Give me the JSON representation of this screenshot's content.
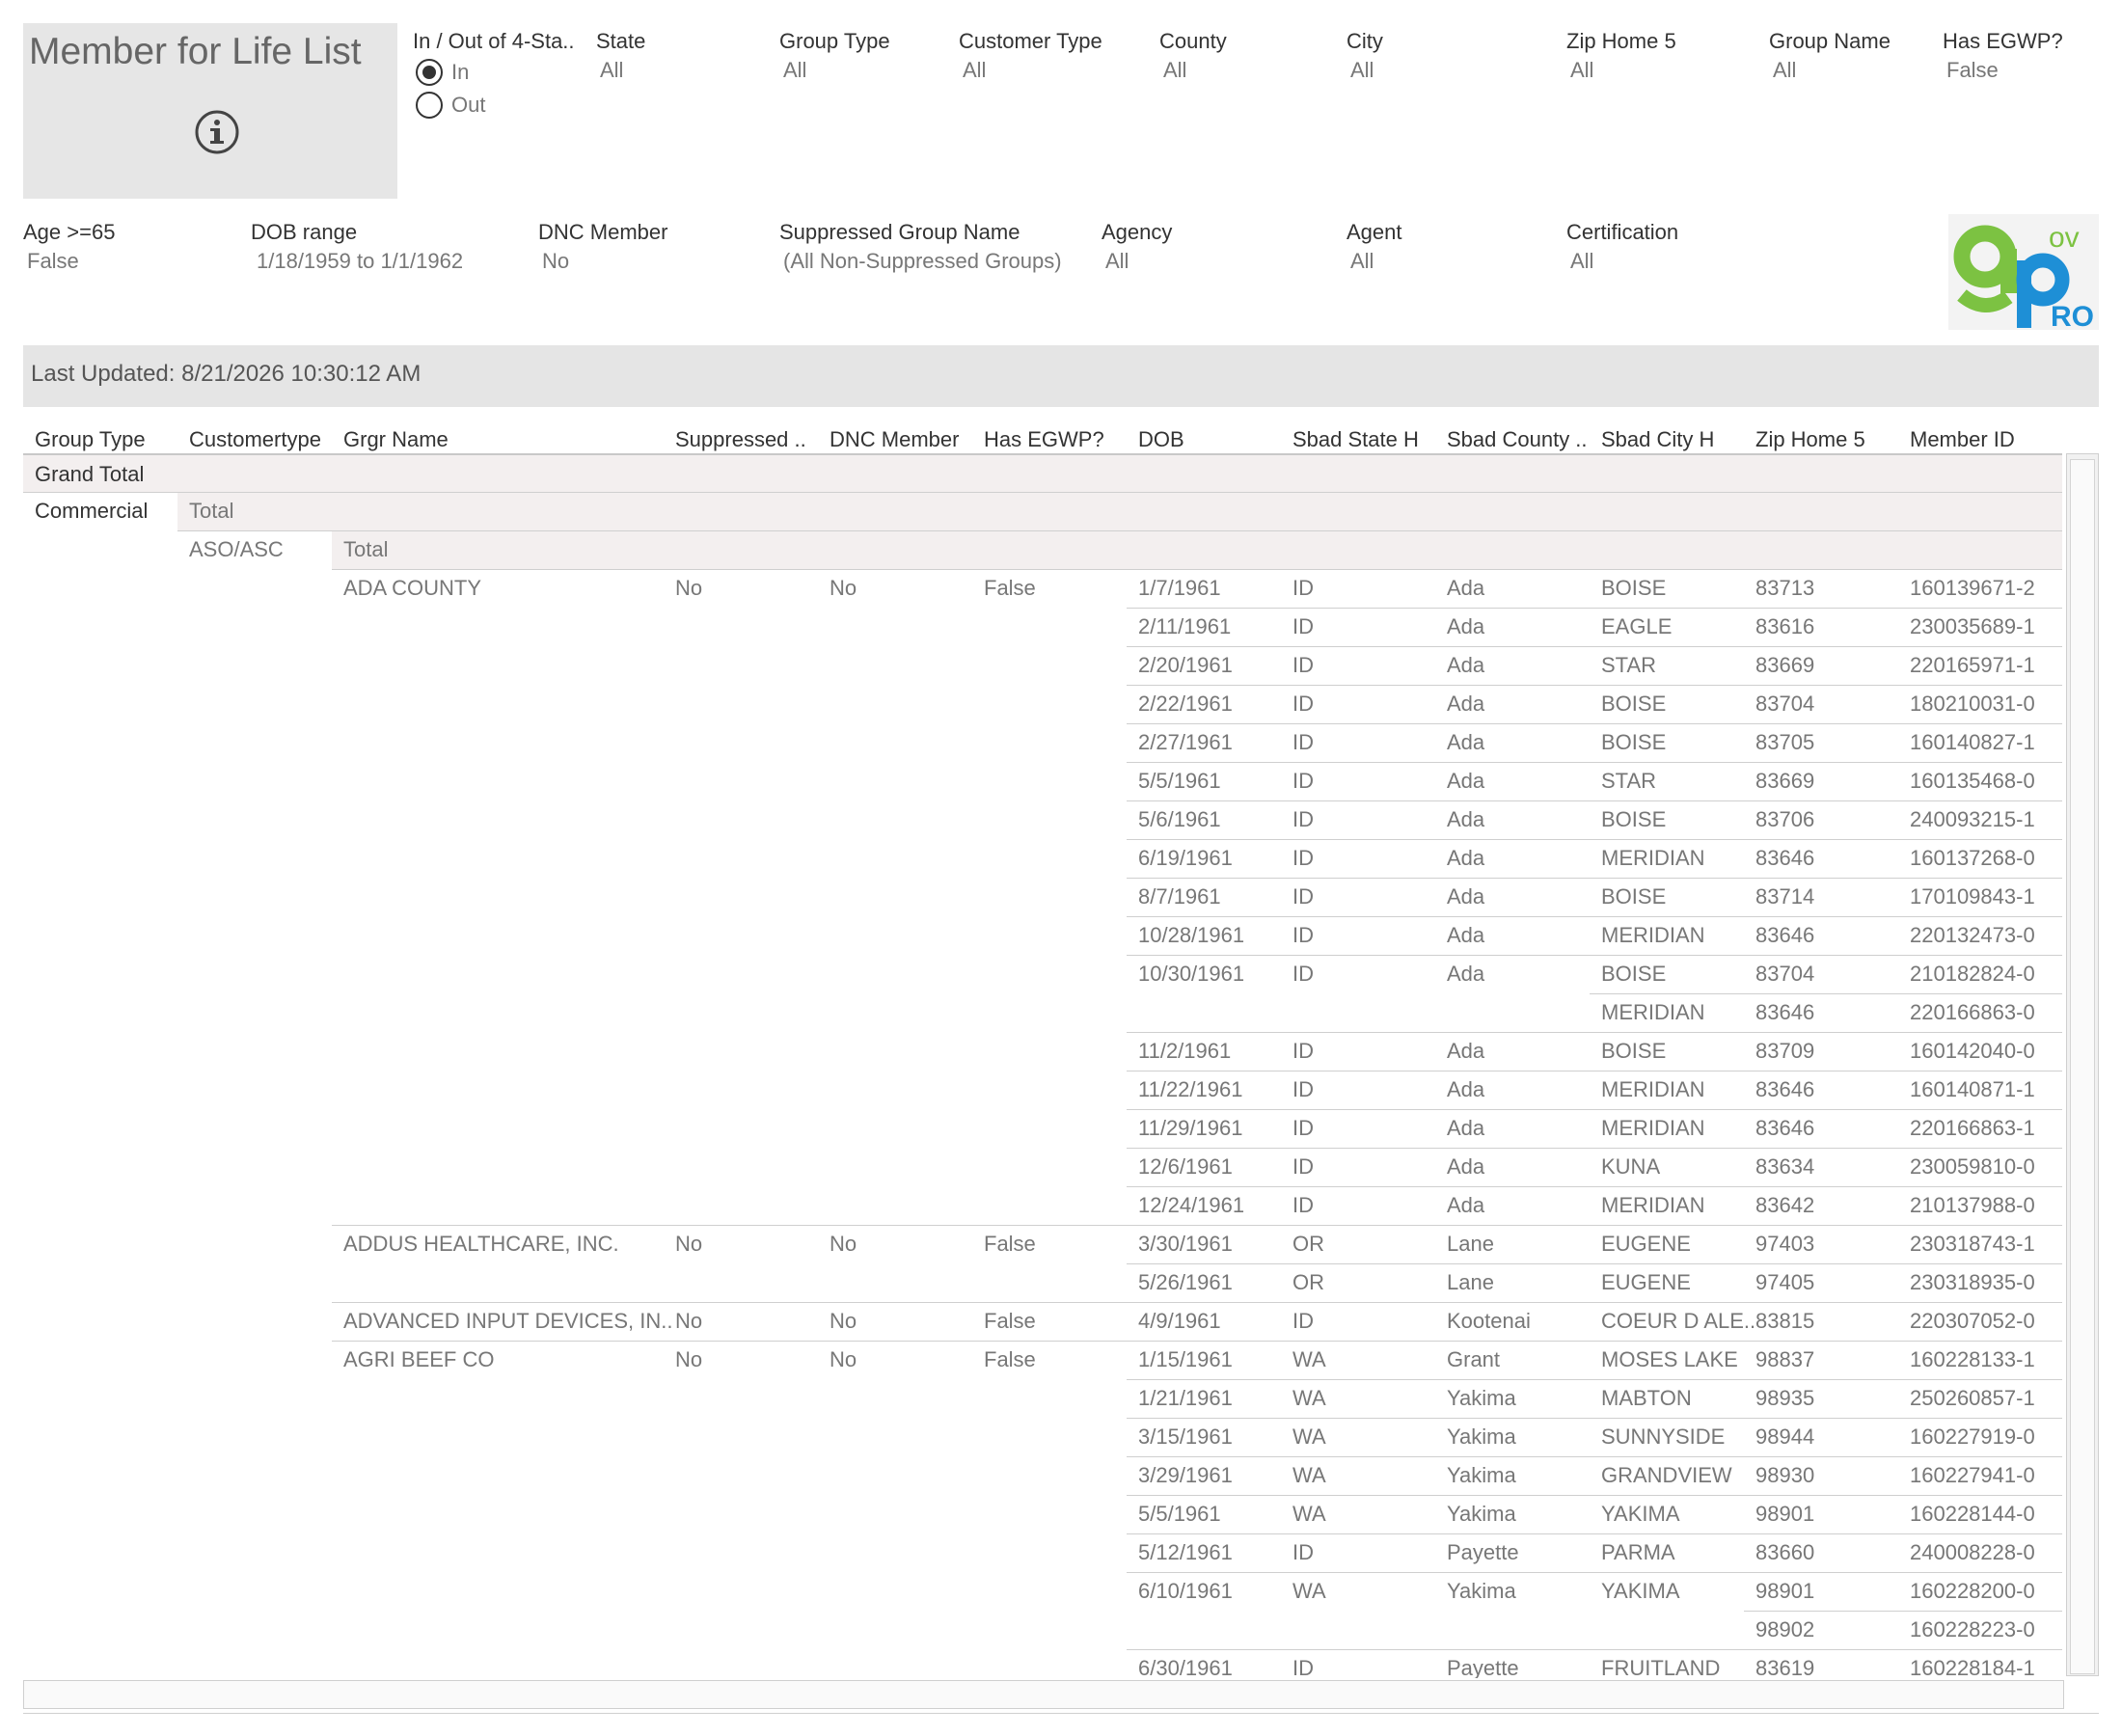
{
  "title": "Member for Life List",
  "filters_row1": [
    {
      "label": "In / Out of 4-Sta..",
      "kind": "radio",
      "options": [
        {
          "label": "In",
          "checked": true
        },
        {
          "label": "Out",
          "checked": false
        }
      ]
    },
    {
      "label": "State",
      "value": "All"
    },
    {
      "label": "Group Type",
      "value": "All"
    },
    {
      "label": "Customer Type",
      "value": "All"
    },
    {
      "label": "County",
      "value": "All"
    },
    {
      "label": "City",
      "value": "All"
    },
    {
      "label": "Zip Home 5",
      "value": "All"
    },
    {
      "label": "Group Name",
      "value": "All"
    },
    {
      "label": "Has EGWP?",
      "value": "False"
    }
  ],
  "filters_row2": [
    {
      "label": "Age >=65",
      "value": "False"
    },
    {
      "label": "DOB range",
      "value": "1/18/1959 to 1/1/1962"
    },
    {
      "label": "DNC Member",
      "value": "No"
    },
    {
      "label": "Suppressed Group Name",
      "value": "(All Non-Suppressed Groups)"
    },
    {
      "label": "Agency",
      "value": "All"
    },
    {
      "label": "Agent",
      "value": "All"
    },
    {
      "label": "Certification",
      "value": "All"
    }
  ],
  "logo": {
    "text_go": "g",
    "text_ov": "ov",
    "text_ro": "RO",
    "green": "#7cc242",
    "blue": "#1e8fd6"
  },
  "last_updated": "Last Updated: 8/21/2026 10:30:12 AM",
  "table": {
    "headers": [
      "Group Type",
      "Customertype",
      "Grgr Name",
      "Suppressed ..",
      "DNC Member",
      "Has EGWP?",
      "DOB",
      "Sbad State H",
      "Sbad County ..",
      "Sbad City H",
      "Zip Home 5",
      "Member ID"
    ],
    "grand_total_label": "Grand Total",
    "group_type": "Commercial",
    "total_label": "Total",
    "customer_type": "ASO/ASC",
    "groups": [
      {
        "name": "ADA COUNTY",
        "suppressed": "No",
        "dnc": "No",
        "egwp": "False",
        "rows": [
          {
            "dob": "1/7/1961",
            "state": "ID",
            "county": "Ada",
            "city": "BOISE",
            "zip": "83713",
            "id": "160139671-2"
          },
          {
            "dob": "2/11/1961",
            "state": "ID",
            "county": "Ada",
            "city": "EAGLE",
            "zip": "83616",
            "id": "230035689-1"
          },
          {
            "dob": "2/20/1961",
            "state": "ID",
            "county": "Ada",
            "city": "STAR",
            "zip": "83669",
            "id": "220165971-1"
          },
          {
            "dob": "2/22/1961",
            "state": "ID",
            "county": "Ada",
            "city": "BOISE",
            "zip": "83704",
            "id": "180210031-0"
          },
          {
            "dob": "2/27/1961",
            "state": "ID",
            "county": "Ada",
            "city": "BOISE",
            "zip": "83705",
            "id": "160140827-1"
          },
          {
            "dob": "5/5/1961",
            "state": "ID",
            "county": "Ada",
            "city": "STAR",
            "zip": "83669",
            "id": "160135468-0"
          },
          {
            "dob": "5/6/1961",
            "state": "ID",
            "county": "Ada",
            "city": "BOISE",
            "zip": "83706",
            "id": "240093215-1"
          },
          {
            "dob": "6/19/1961",
            "state": "ID",
            "county": "Ada",
            "city": "MERIDIAN",
            "zip": "83646",
            "id": "160137268-0"
          },
          {
            "dob": "8/7/1961",
            "state": "ID",
            "county": "Ada",
            "city": "BOISE",
            "zip": "83714",
            "id": "170109843-1"
          },
          {
            "dob": "10/28/1961",
            "state": "ID",
            "county": "Ada",
            "city": "MERIDIAN",
            "zip": "83646",
            "id": "220132473-0"
          },
          {
            "dob": "10/30/1961",
            "state": "ID",
            "county": "Ada",
            "city": "BOISE",
            "zip": "83704",
            "id": "210182824-0"
          },
          {
            "dob": "",
            "state": "",
            "county": "",
            "city": "MERIDIAN",
            "zip": "83646",
            "id": "220166863-0"
          },
          {
            "dob": "11/2/1961",
            "state": "ID",
            "county": "Ada",
            "city": "BOISE",
            "zip": "83709",
            "id": "160142040-0"
          },
          {
            "dob": "11/22/1961",
            "state": "ID",
            "county": "Ada",
            "city": "MERIDIAN",
            "zip": "83646",
            "id": "160140871-1"
          },
          {
            "dob": "11/29/1961",
            "state": "ID",
            "county": "Ada",
            "city": "MERIDIAN",
            "zip": "83646",
            "id": "220166863-1"
          },
          {
            "dob": "12/6/1961",
            "state": "ID",
            "county": "Ada",
            "city": "KUNA",
            "zip": "83634",
            "id": "230059810-0"
          },
          {
            "dob": "12/24/1961",
            "state": "ID",
            "county": "Ada",
            "city": "MERIDIAN",
            "zip": "83642",
            "id": "210137988-0"
          }
        ]
      },
      {
        "name": "ADDUS HEALTHCARE, INC.",
        "suppressed": "No",
        "dnc": "No",
        "egwp": "False",
        "rows": [
          {
            "dob": "3/30/1961",
            "state": "OR",
            "county": "Lane",
            "city": "EUGENE",
            "zip": "97403",
            "id": "230318743-1"
          },
          {
            "dob": "5/26/1961",
            "state": "OR",
            "county": "Lane",
            "city": "EUGENE",
            "zip": "97405",
            "id": "230318935-0"
          }
        ]
      },
      {
        "name": "ADVANCED INPUT DEVICES, IN..",
        "suppressed": "No",
        "dnc": "No",
        "egwp": "False",
        "rows": [
          {
            "dob": "4/9/1961",
            "state": "ID",
            "county": "Kootenai",
            "city": "COEUR D ALE..",
            "zip": "83815",
            "id": "220307052-0"
          }
        ]
      },
      {
        "name": "AGRI BEEF CO",
        "suppressed": "No",
        "dnc": "No",
        "egwp": "False",
        "rows": [
          {
            "dob": "1/15/1961",
            "state": "WA",
            "county": "Grant",
            "city": "MOSES LAKE",
            "zip": "98837",
            "id": "160228133-1"
          },
          {
            "dob": "1/21/1961",
            "state": "WA",
            "county": "Yakima",
            "city": "MABTON",
            "zip": "98935",
            "id": "250260857-1"
          },
          {
            "dob": "3/15/1961",
            "state": "WA",
            "county": "Yakima",
            "city": "SUNNYSIDE",
            "zip": "98944",
            "id": "160227919-0"
          },
          {
            "dob": "3/29/1961",
            "state": "WA",
            "county": "Yakima",
            "city": "GRANDVIEW",
            "zip": "98930",
            "id": "160227941-0"
          },
          {
            "dob": "5/5/1961",
            "state": "WA",
            "county": "Yakima",
            "city": "YAKIMA",
            "zip": "98901",
            "id": "160228144-0"
          },
          {
            "dob": "5/12/1961",
            "state": "ID",
            "county": "Payette",
            "city": "PARMA",
            "zip": "83660",
            "id": "240008228-0"
          },
          {
            "dob": "6/10/1961",
            "state": "WA",
            "county": "Yakima",
            "city": "YAKIMA",
            "zip": "98901",
            "id": "160228200-0"
          },
          {
            "dob": "",
            "state": "",
            "county": "",
            "city": "",
            "zip": "98902",
            "id": "160228223-0"
          },
          {
            "dob": "6/30/1961",
            "state": "ID",
            "county": "Payette",
            "city": "FRUITLAND",
            "zip": "83619",
            "id": "160228184-1"
          }
        ]
      }
    ]
  }
}
